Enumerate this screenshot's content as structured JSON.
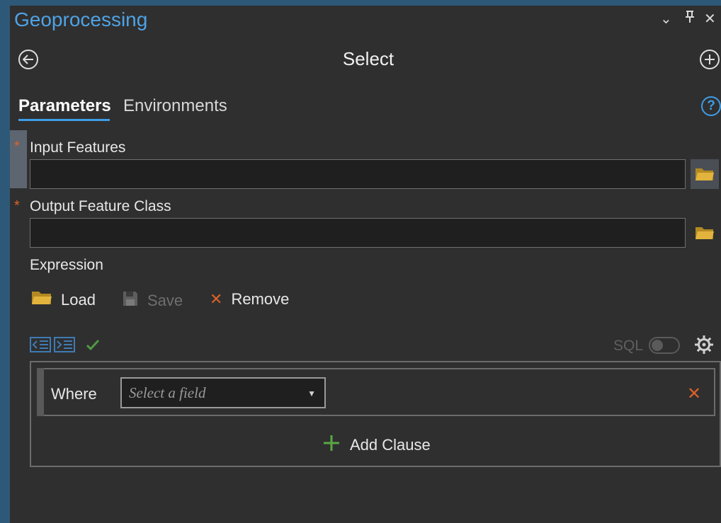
{
  "pane": {
    "title": "Geoprocessing",
    "controls": {
      "menu": "⌄",
      "pin": "⊥",
      "close": "✕"
    }
  },
  "tool": {
    "title": "Select",
    "back_icon": "back-arrow-icon",
    "add_icon": "plus-circle-icon"
  },
  "tabs": [
    {
      "label": "Parameters",
      "active": true
    },
    {
      "label": "Environments",
      "active": false
    }
  ],
  "help_glyph": "?",
  "parameters": {
    "input_features": {
      "label": "Input Features",
      "required_mark": "*",
      "value": ""
    },
    "output_feature_class": {
      "label": "Output Feature Class",
      "required_mark": "*",
      "value": ""
    },
    "expression": {
      "label": "Expression"
    }
  },
  "expression_toolbar": {
    "load_label": "Load",
    "save_label": "Save",
    "remove_label": "Remove",
    "remove_glyph": "✕"
  },
  "sql_label": "SQL",
  "clause": {
    "where_label": "Where",
    "field_placeholder": "Select a field",
    "remove_glyph": "✕"
  },
  "add_clause_label": "Add Clause",
  "add_clause_glyph": "+",
  "colors": {
    "accent": "#3e9de6",
    "title_blue": "#4ea3e6",
    "required": "#d9622b",
    "remove_red": "#d9622b",
    "add_green": "#5aa845",
    "folder_yellow": "#e3b43d",
    "check_green": "#4f9a43"
  }
}
